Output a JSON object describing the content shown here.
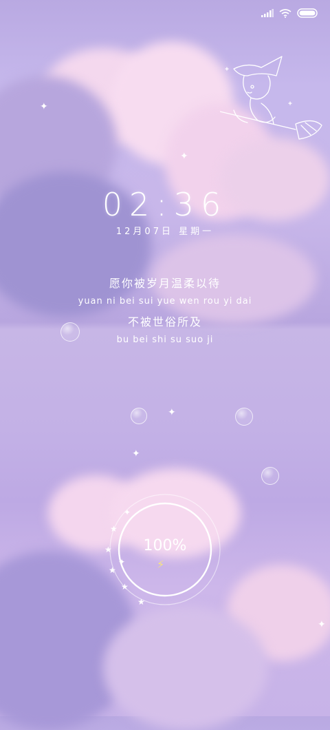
{
  "status_bar": {
    "signal_icon": "signal-icon",
    "wifi_icon": "wifi-icon",
    "battery_icon": "battery-icon"
  },
  "lockscreen": {
    "time": "02:36",
    "date": "12月07日 星期一",
    "poem_line1_cn": "愿你被岁月温柔以待",
    "poem_line1_pinyin": "yuan ni bei sui yue wen rou yi dai",
    "poem_line2_cn": "不被世俗所及",
    "poem_line2_pinyin": "bu bei shi su suo ji"
  },
  "battery": {
    "percent_label": "100%",
    "level": 1.0,
    "charging_icon": "lightning-bolt-icon"
  },
  "colors": {
    "text": "#ffffff",
    "background": "#c3b3e8",
    "bolt": "#f7e47e"
  }
}
